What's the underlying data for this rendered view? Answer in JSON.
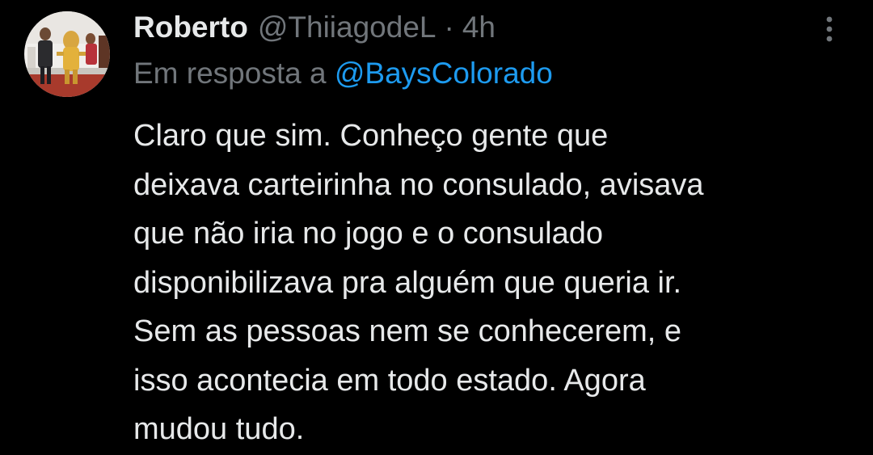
{
  "tweet": {
    "display_name": "Roberto",
    "handle": "@ThiiagodeL",
    "separator": "·",
    "time": "4h",
    "reply_prefix": "Em resposta a",
    "reply_mention": "@BaysColorado",
    "text_lines": [
      "Claro que sim. Conheço gente que",
      "deixava carteirinha no consulado, avisava",
      "que não iria no jogo e o consulado",
      "disponibilizava pra alguém que queria ir.",
      "Sem as pessoas nem se conhecerem, e",
      "isso acontecia em todo estado. Agora",
      "mudou tudo."
    ]
  },
  "icons": {
    "more": "more-vertical-icon"
  },
  "colors": {
    "background": "#000000",
    "primary_text": "#e7e9ea",
    "secondary_text": "#71767b",
    "link": "#1d9bf0"
  }
}
